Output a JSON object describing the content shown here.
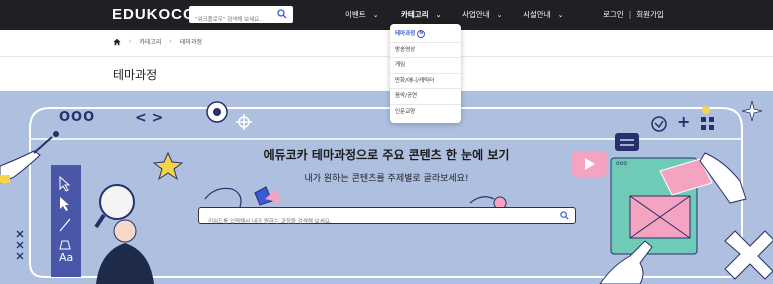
{
  "header": {
    "logo": "EDUKOCCA",
    "search_placeholder": "\"워크플로우\" 검색해 보세요.",
    "nav": [
      {
        "label": "이벤트"
      },
      {
        "label": "카테고리"
      },
      {
        "label": "사업안내"
      },
      {
        "label": "시설안내"
      }
    ],
    "login": "로그인",
    "separator": "|",
    "signup": "회원가입"
  },
  "dropdown": {
    "items": [
      {
        "label": "테마과정",
        "badge": "N"
      },
      {
        "label": "방송영상"
      },
      {
        "label": "게임"
      },
      {
        "label": "만화/애니/캐릭터"
      },
      {
        "label": "음악/공연"
      },
      {
        "label": "인문교양"
      }
    ]
  },
  "breadcrumb": {
    "items": [
      "카테고리",
      "테마과정"
    ]
  },
  "page": {
    "title": "테마과정"
  },
  "hero": {
    "title": "에듀코카 테마과정으로 주요 콘텐츠 한 눈에 보기",
    "subtitle": "내가 원하는 콘텐츠를 주제별로 골라보세요!",
    "search_placeholder": "키워드를 입력해서 내가 원하는 과정을 검색해 보세요.",
    "dots": "OOO",
    "arrows": "< >",
    "plus": "+",
    "aa": "Aa",
    "mini_dots": "ooo",
    "colors": {
      "bg": "#aebfe0",
      "frame": "#ffffff",
      "navy": "#26306b",
      "pink": "#f4a3c1",
      "teal": "#6fcab8",
      "yellow": "#f6d44a"
    }
  },
  "colors": {
    "topbar": "#1f1f24",
    "accent": "#3a5bd9"
  }
}
